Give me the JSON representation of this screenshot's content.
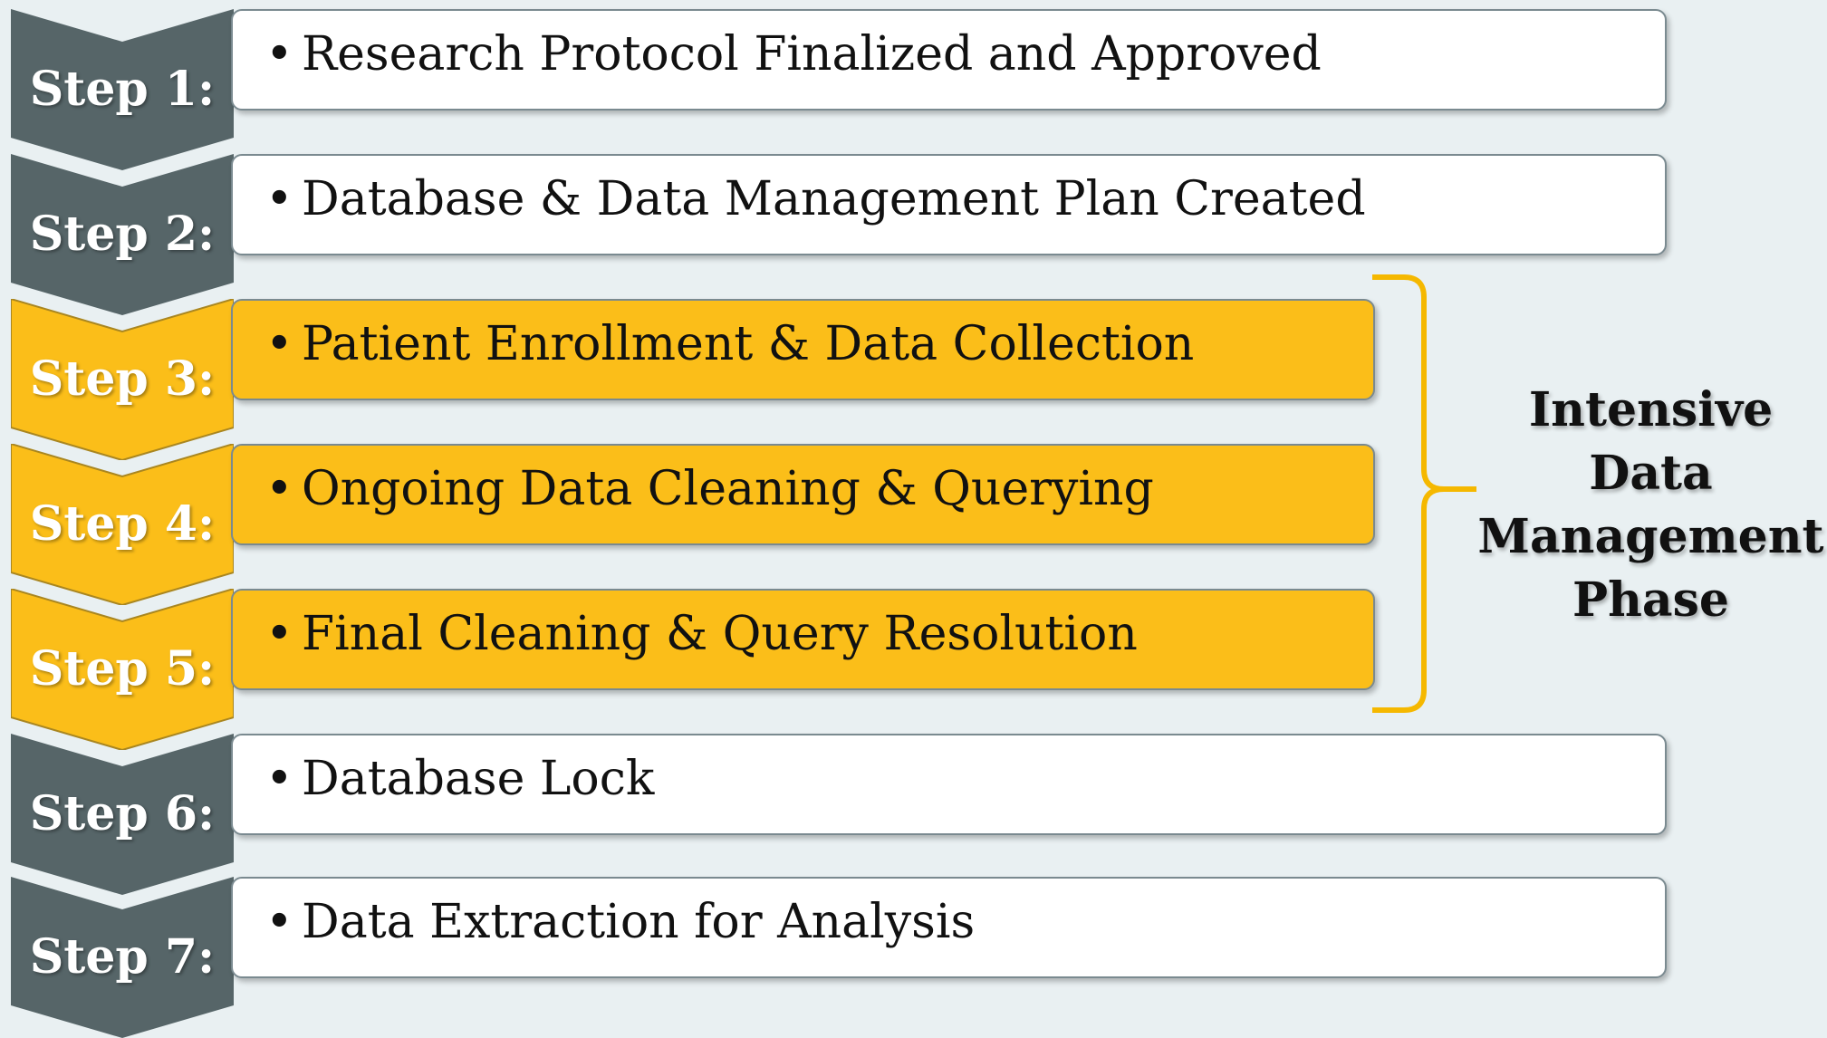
{
  "colors": {
    "chevron_gray": "#566568",
    "chevron_yellow": "#fbbe19",
    "box_white": "#ffffff",
    "box_yellow": "#fbbe19",
    "bracket": "#f5b800",
    "background": "#e9f0f2"
  },
  "steps": [
    {
      "label": "Step 1:",
      "text": "Research Protocol Finalized and Approved",
      "highlight": false
    },
    {
      "label": "Step 2:",
      "text": "Database & Data Management Plan Created",
      "highlight": false
    },
    {
      "label": "Step 3:",
      "text": "Patient Enrollment & Data Collection",
      "highlight": true
    },
    {
      "label": "Step 4:",
      "text": "Ongoing Data Cleaning & Querying",
      "highlight": true
    },
    {
      "label": "Step 5:",
      "text": "Final Cleaning & Query Resolution",
      "highlight": true
    },
    {
      "label": "Step 6:",
      "text": "Database Lock",
      "highlight": false
    },
    {
      "label": "Step 7:",
      "text": "Data Extraction for Analysis",
      "highlight": false
    }
  ],
  "bullet": "•",
  "phase": {
    "lines": [
      "Intensive",
      "Data",
      "Management",
      "Phase"
    ]
  }
}
